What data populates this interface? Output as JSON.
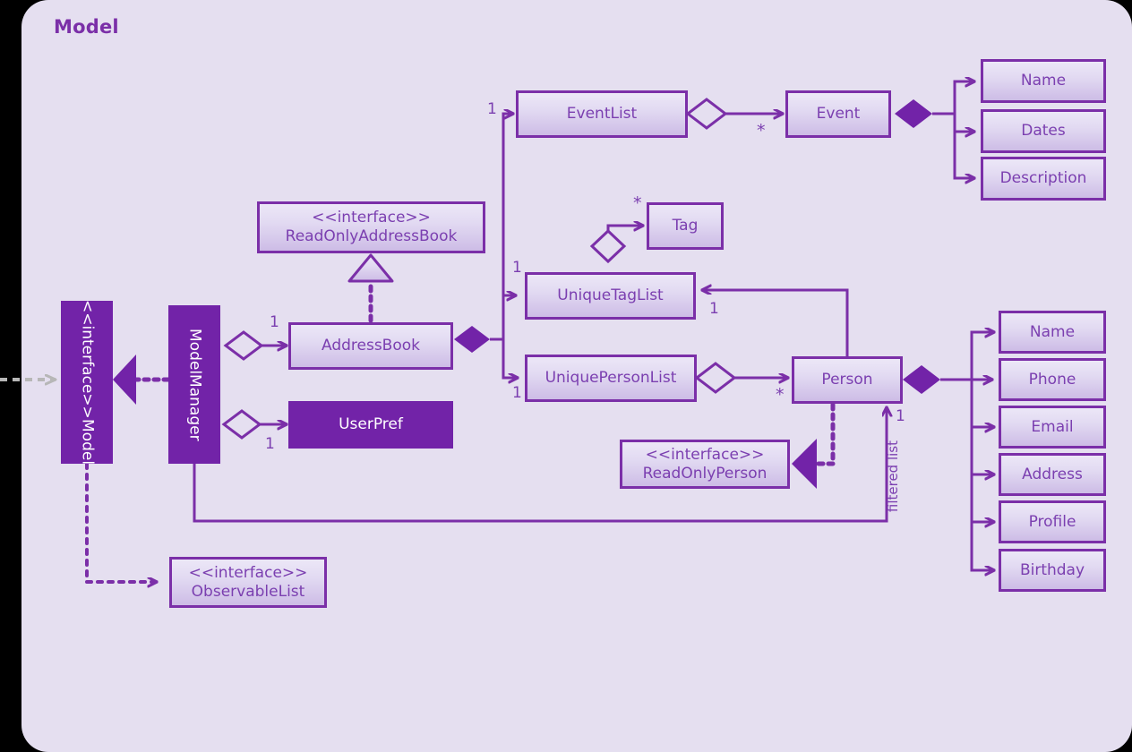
{
  "diagram": {
    "title": "Model",
    "type": "uml-class-diagram",
    "colors": {
      "panel_background": "#e5dff0",
      "accent": "#7b2fa8",
      "node_fill_top": "#ece7f7",
      "node_fill_bottom": "#cdbce6",
      "solid_fill": "#7223a8",
      "text": "#7b3fb0",
      "external_arrow": "#b7b7b7",
      "page_background": "#000000"
    }
  },
  "nodes": {
    "model": {
      "stereotype": "<<interface>>",
      "name": "Model",
      "style": "solid-vertical"
    },
    "model_manager": {
      "name": "ModelManager",
      "style": "solid-vertical"
    },
    "read_only_address_book": {
      "stereotype": "<<interface>>",
      "name": "ReadOnlyAddressBook",
      "style": "outline"
    },
    "address_book": {
      "name": "AddressBook",
      "style": "outline"
    },
    "user_pref": {
      "name": "UserPref",
      "style": "solid"
    },
    "observable_list": {
      "stereotype": "<<interface>>",
      "name": "ObservableList",
      "style": "outline"
    },
    "event_list": {
      "name": "EventList",
      "style": "outline"
    },
    "event": {
      "name": "Event",
      "style": "outline"
    },
    "tag": {
      "name": "Tag",
      "style": "outline"
    },
    "unique_tag_list": {
      "name": "UniqueTagList",
      "style": "outline"
    },
    "unique_person_list": {
      "name": "UniquePersonList",
      "style": "outline"
    },
    "person": {
      "name": "Person",
      "style": "outline"
    },
    "read_only_person": {
      "stereotype": "<<interface>>",
      "name": "ReadOnlyPerson",
      "style": "outline"
    }
  },
  "event_attributes": [
    {
      "name": "Name"
    },
    {
      "name": "Dates"
    },
    {
      "name": "Description"
    }
  ],
  "person_attributes": [
    {
      "name": "Name"
    },
    {
      "name": "Phone"
    },
    {
      "name": "Email"
    },
    {
      "name": "Address"
    },
    {
      "name": "Profile"
    },
    {
      "name": "Birthday"
    }
  ],
  "multiplicities": {
    "model_manager_to_address_book": "1",
    "model_manager_to_user_pref": "1",
    "address_book_to_event_list": "1",
    "address_book_to_unique_tag_list": "1",
    "address_book_to_unique_person_list": "1",
    "event_list_to_event": "*",
    "unique_tag_list_to_tag": "*",
    "unique_person_list_to_person": "*",
    "person_to_unique_tag_list": "1",
    "model_manager_filtered_to_person": "1"
  },
  "edge_labels": {
    "filtered_list": "filtered list"
  },
  "relationships": [
    {
      "from": "model_manager",
      "to": "model",
      "type": "realization"
    },
    {
      "from": "model_manager",
      "to": "address_book",
      "type": "aggregation",
      "multiplicity": "1"
    },
    {
      "from": "model_manager",
      "to": "user_pref",
      "type": "aggregation",
      "multiplicity": "1"
    },
    {
      "from": "address_book",
      "to": "read_only_address_book",
      "type": "realization"
    },
    {
      "from": "model",
      "to": "observable_list",
      "type": "dependency"
    },
    {
      "from": "address_book",
      "to": "event_list",
      "type": "composition",
      "multiplicity": "1"
    },
    {
      "from": "address_book",
      "to": "unique_tag_list",
      "type": "composition",
      "multiplicity": "1"
    },
    {
      "from": "address_book",
      "to": "unique_person_list",
      "type": "composition",
      "multiplicity": "1"
    },
    {
      "from": "event_list",
      "to": "event",
      "type": "aggregation",
      "multiplicity": "*"
    },
    {
      "from": "event",
      "to": "event_attributes",
      "type": "composition"
    },
    {
      "from": "unique_tag_list",
      "to": "tag",
      "type": "aggregation",
      "multiplicity": "*"
    },
    {
      "from": "unique_person_list",
      "to": "person",
      "type": "aggregation",
      "multiplicity": "*"
    },
    {
      "from": "person",
      "to": "unique_tag_list",
      "type": "association",
      "multiplicity": "1"
    },
    {
      "from": "person",
      "to": "person_attributes",
      "type": "composition"
    },
    {
      "from": "person",
      "to": "read_only_person",
      "type": "realization"
    },
    {
      "from": "model_manager",
      "to": "person",
      "type": "association",
      "label": "filtered list",
      "multiplicity": "1"
    }
  ]
}
